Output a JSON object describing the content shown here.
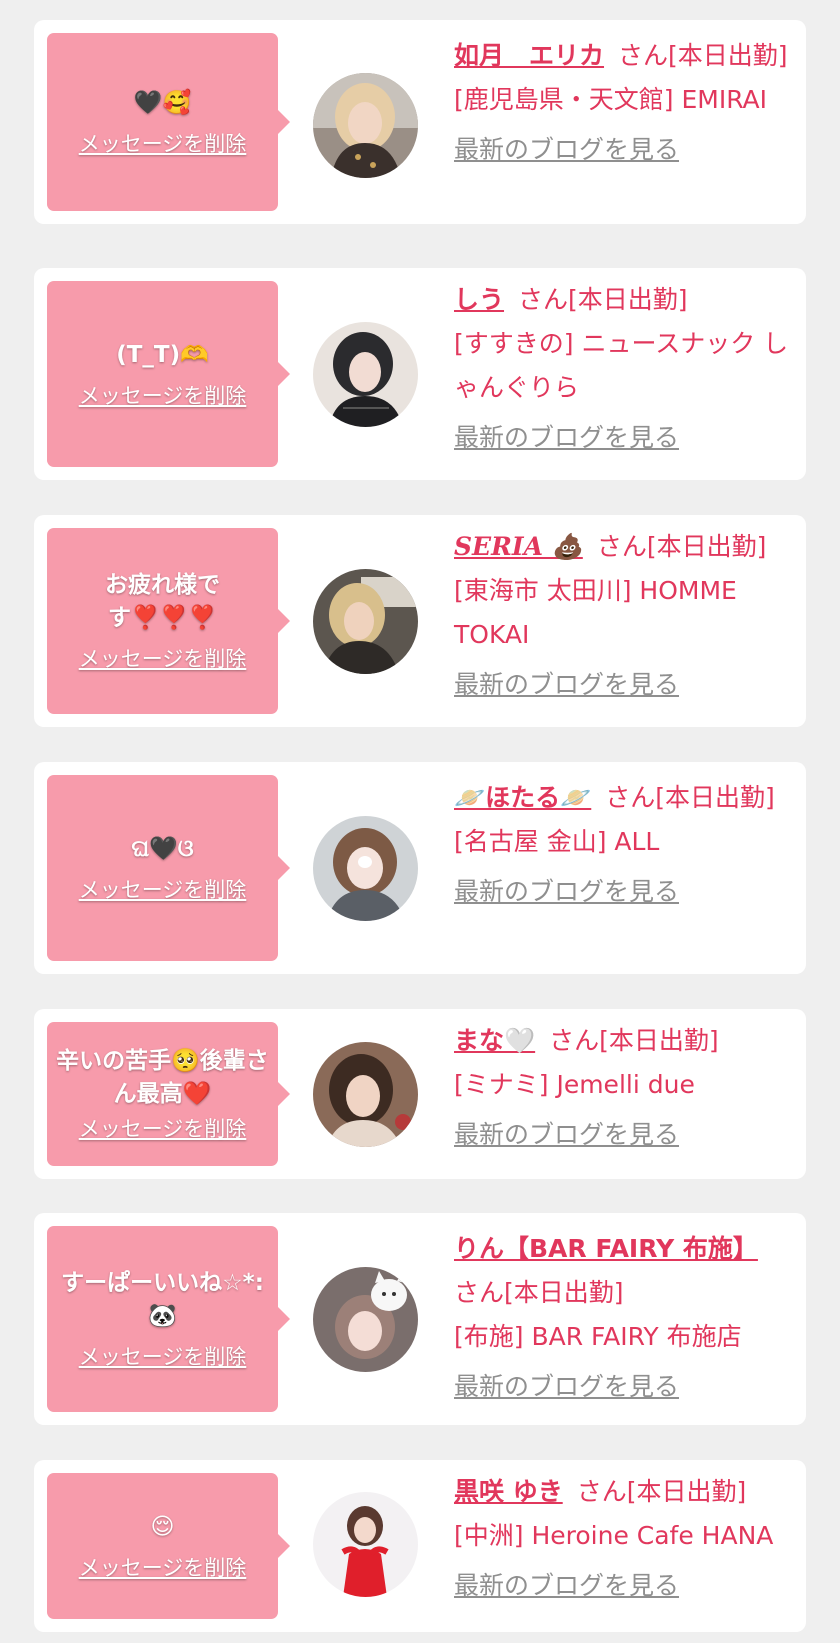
{
  "common": {
    "delete_label": "メッセージを削除",
    "blog_label": "最新のブログを見る"
  },
  "colors": {
    "background": "#efefef",
    "card": "#ffffff",
    "bubble": "#f79bab",
    "accent": "#e1375c",
    "link_gray": "#8f8f8f"
  },
  "items": [
    {
      "message": "🖤🥰",
      "name": "如月　エリカ",
      "status": "さん[本日出勤]",
      "shop": "[鹿児島県・天文館] EMIRAI",
      "avatar": "photo-woman-blonde-hair"
    },
    {
      "message": "(T_T)🫶",
      "name": "しう",
      "status": "さん[本日出勤]",
      "shop": "[すすきの] ニュースナック しゃんぐりら",
      "avatar": "photo-woman-dark-hair"
    },
    {
      "message": "お疲れ様です❣️❣️❣️",
      "name": "SERIA 💩",
      "status": "さん[本日出勤]",
      "shop": "[東海市 太田川] HOMME TOKAI",
      "avatar": "photo-woman-blonde-dark-bg"
    },
    {
      "message": "ଘ🖤ଓ",
      "name": "🪐ほたる🪐",
      "status": "さん[本日出勤]",
      "shop": "[名古屋 金山] ALL",
      "avatar": "photo-woman-cat-filter"
    },
    {
      "message": "辛いの苦手🥺後輩さん最高❤️",
      "name": "まな🤍",
      "status": "さん[本日出勤]",
      "shop": "[ミナミ] Jemelli due",
      "avatar": "photo-woman-brown-hair"
    },
    {
      "message": "すーぱーいいね☆*:🐼",
      "name": "りん【BAR FAIRY 布施】",
      "status": "さん[本日出勤]",
      "shop": "[布施] BAR FAIRY 布施店",
      "avatar": "photo-woman-white-cat"
    },
    {
      "message": "😌",
      "name": "黒咲 ゆき",
      "status": "さん[本日出勤]",
      "shop": "[中洲] Heroine Cafe HANA",
      "avatar": "photo-woman-red-dress"
    }
  ]
}
